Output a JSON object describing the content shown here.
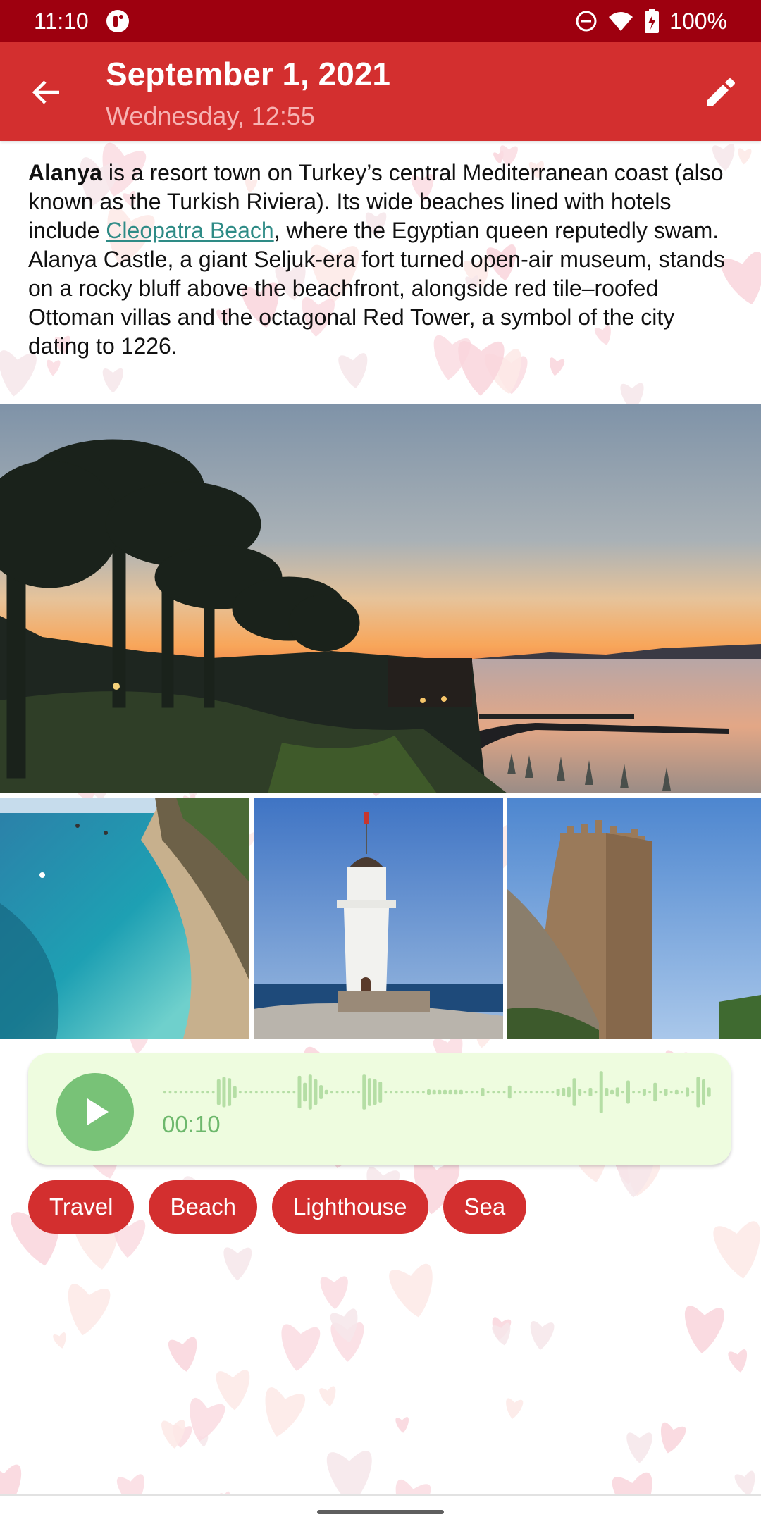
{
  "status_bar": {
    "time": "11:10",
    "battery_percent": "100%",
    "icons": [
      "app-notification-icon",
      "do-not-disturb-icon",
      "wifi-icon",
      "battery-charging-icon"
    ]
  },
  "app_bar": {
    "title": "September 1, 2021",
    "subtitle": "Wednesday, 12:55",
    "back_icon": "arrow-left-icon",
    "edit_icon": "pencil-icon"
  },
  "entry": {
    "bold_lead": "Alanya",
    "text_part1": " is a resort town on Turkey’s central Mediterranean coast (also known as the Turkish Riviera). Its wide beaches lined with hotels include ",
    "link_text": "Cleopatra Beach",
    "text_part2": ", where the Egyptian queen reputedly swam. Alanya Castle, a giant Seljuk-era fort turned open-air museum, stands on a rocky bluff above the beachfront, alongside red tile–roofed Ottoman villas and the octagonal Red Tower, a symbol of the city dating to 1226."
  },
  "photos": [
    {
      "name": "sunset-palms-photo",
      "description": "Sunset over the sea with palm trees"
    },
    {
      "name": "beach-bay-photo",
      "description": "Turquoise bay with boats and beach"
    },
    {
      "name": "lighthouse-photo",
      "description": "White lighthouse with flag"
    },
    {
      "name": "red-tower-photo",
      "description": "Stone Red Tower with battlements"
    }
  ],
  "audio": {
    "duration": "00:10",
    "play_icon": "play-icon",
    "waveform": [
      0,
      0,
      0,
      0,
      0,
      0,
      0,
      0,
      0,
      0,
      0.55,
      0.65,
      0.6,
      0.25,
      0,
      0,
      0,
      0,
      0,
      0,
      0,
      0,
      0,
      0,
      0,
      0.7,
      0.4,
      0.75,
      0.55,
      0.3,
      0.1,
      0,
      0,
      0,
      0,
      0,
      0,
      0.75,
      0.6,
      0.55,
      0.45,
      0,
      0,
      0,
      0,
      0,
      0,
      0,
      0,
      0.12,
      0.1,
      0.1,
      0.1,
      0.1,
      0.1,
      0.1,
      0,
      0,
      0,
      0.18,
      0,
      0,
      0,
      0,
      0.28,
      0,
      0,
      0,
      0,
      0,
      0,
      0,
      0,
      0.15,
      0.18,
      0.22,
      0.6,
      0.15,
      0,
      0.18,
      0,
      0.9,
      0.18,
      0.1,
      0.2,
      0,
      0.5,
      0,
      0,
      0.15,
      0,
      0.4,
      0,
      0.15,
      0,
      0.1,
      0,
      0.2,
      0,
      0.65,
      0.55,
      0.2
    ],
    "colors": {
      "background": "#eefcdf",
      "accent": "#78c277",
      "wave": "#b5dea5",
      "text": "#6db86c"
    }
  },
  "tags": [
    "Travel",
    "Beach",
    "Lighthouse",
    "Sea"
  ],
  "colors": {
    "status_bar": "#9e000f",
    "app_bar": "#d32f2f",
    "subtitle": "#f7b3b3",
    "link": "#2e8b86",
    "tag": "#d32f2f"
  }
}
